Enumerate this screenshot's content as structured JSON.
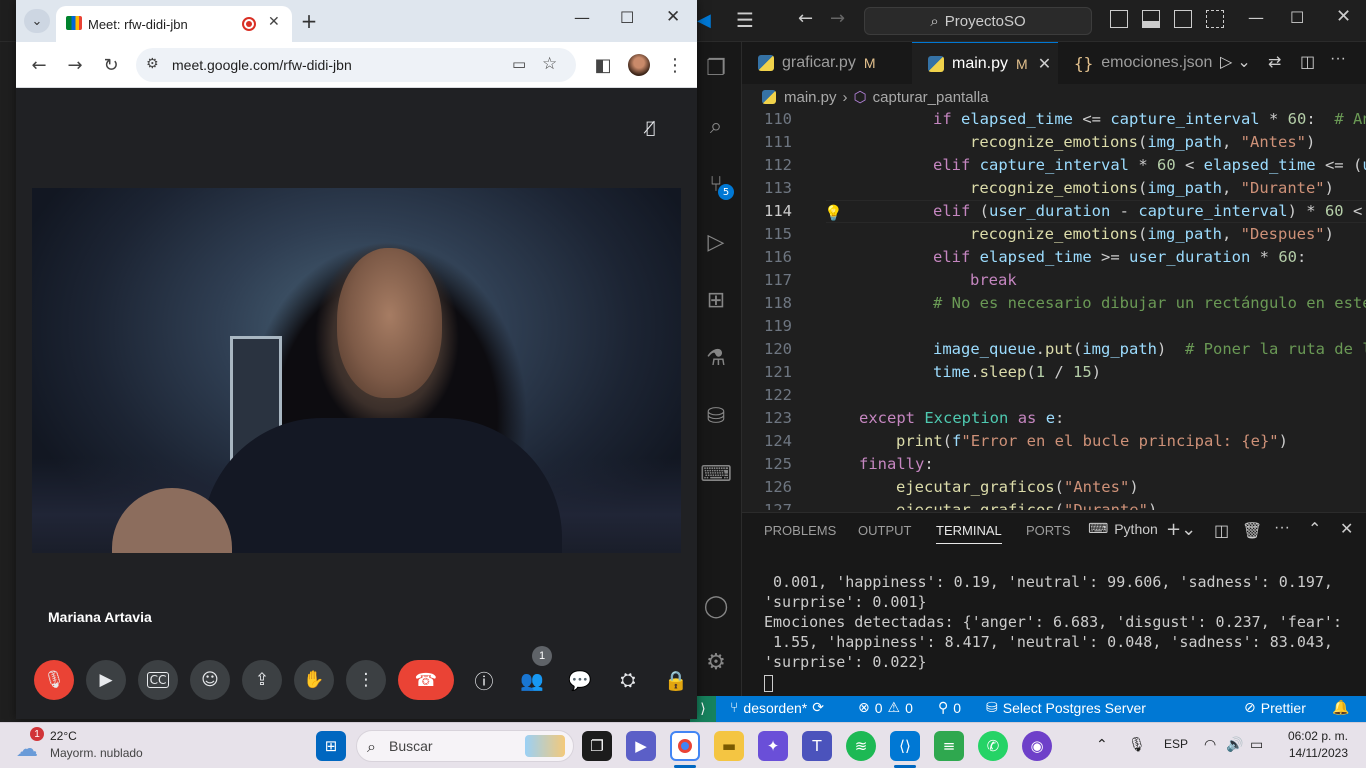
{
  "vscode": {
    "search": "ProyectoSO",
    "tabs": [
      {
        "label": "graficar.py",
        "mod": "M"
      },
      {
        "label": "main.py",
        "mod": "M"
      },
      {
        "label": "emociones.json",
        "mod": ""
      }
    ],
    "breadcrumb": {
      "file": "main.py",
      "symbol": "capturar_pantalla"
    },
    "scm_badge": "5",
    "code_lines": [
      {
        "n": "110",
        "c": ""
      },
      {
        "n": "111",
        "c": ""
      },
      {
        "n": "112",
        "c": ""
      },
      {
        "n": "113",
        "c": ""
      },
      {
        "n": "114",
        "c": ""
      },
      {
        "n": "115",
        "c": ""
      },
      {
        "n": "116",
        "c": ""
      },
      {
        "n": "117",
        "c": ""
      },
      {
        "n": "118",
        "c": ""
      },
      {
        "n": "119",
        "c": ""
      },
      {
        "n": "120",
        "c": ""
      },
      {
        "n": "121",
        "c": ""
      },
      {
        "n": "122",
        "c": ""
      },
      {
        "n": "123",
        "c": ""
      },
      {
        "n": "124",
        "c": ""
      },
      {
        "n": "125",
        "c": ""
      },
      {
        "n": "126",
        "c": ""
      },
      {
        "n": "127",
        "c": ""
      }
    ],
    "panel_tabs": [
      "PROBLEMS",
      "OUTPUT",
      "TERMINAL",
      "PORTS"
    ],
    "terminal_shell": "Python",
    "terminal_lines": [
      " 0.001, 'happiness': 0.19, 'neutral': 99.606, 'sadness': 0.197,",
      "'surprise': 0.001}",
      "Emociones detectadas: {'anger': 6.683, 'disgust': 0.237, 'fear':",
      " 1.55, 'happiness': 8.417, 'neutral': 0.048, 'sadness': 83.043,",
      "'surprise': 0.022}"
    ],
    "status": {
      "branch": "desorden*",
      "errors": "0",
      "warnings": "0",
      "ports": "0",
      "postgres": "Select Postgres Server",
      "prettier": "Prettier"
    }
  },
  "chrome": {
    "tab_title": "Meet: rfw-didi-jbn",
    "url": "meet.google.com/rfw-didi-jbn",
    "participant": "Mariana Artavia",
    "people_count": "1"
  },
  "taskbar": {
    "weather_temp": "22°C",
    "weather_desc": "Mayorm. nublado",
    "weather_badge": "1",
    "search_placeholder": "Buscar",
    "lang": "ESP",
    "time": "06:02 p. m.",
    "date": "14/11/2023"
  }
}
